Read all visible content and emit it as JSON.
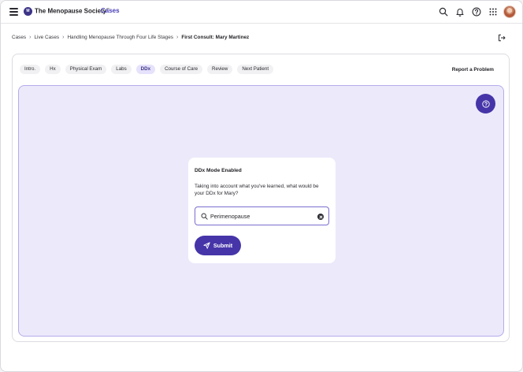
{
  "header": {
    "logo_text": "M",
    "brand_name": "The Menopause Society",
    "brand_trademark": "™",
    "section": "Cases",
    "icons": [
      "menu-icon",
      "search-icon",
      "bell-icon",
      "help-icon",
      "apps-grid-icon",
      "avatar"
    ]
  },
  "breadcrumb": {
    "items": [
      "Cases",
      "Live Cases",
      "Handling Menopause Through Four Life Stages",
      "First Consult: Mary Martinez"
    ]
  },
  "tabs": [
    {
      "label": "Intro.",
      "active": false
    },
    {
      "label": "Hx",
      "active": false
    },
    {
      "label": "Physical Exam",
      "active": false
    },
    {
      "label": "Labs",
      "active": false
    },
    {
      "label": "DDx",
      "active": true
    },
    {
      "label": "Course of Care",
      "active": false
    },
    {
      "label": "Review",
      "active": false
    },
    {
      "label": "Next Patient",
      "active": false
    }
  ],
  "report_link": "Report a Problem",
  "dialog": {
    "title": "DDx Mode Enabled",
    "prompt": "Taking into account what you've learned, what would be your DDx for Mary?",
    "search_value": "Perimenopause",
    "submit_label": "Submit"
  },
  "colors": {
    "accent": "#4535a8",
    "accent_light": "#ece9fb",
    "accent_border": "#b4adea"
  }
}
